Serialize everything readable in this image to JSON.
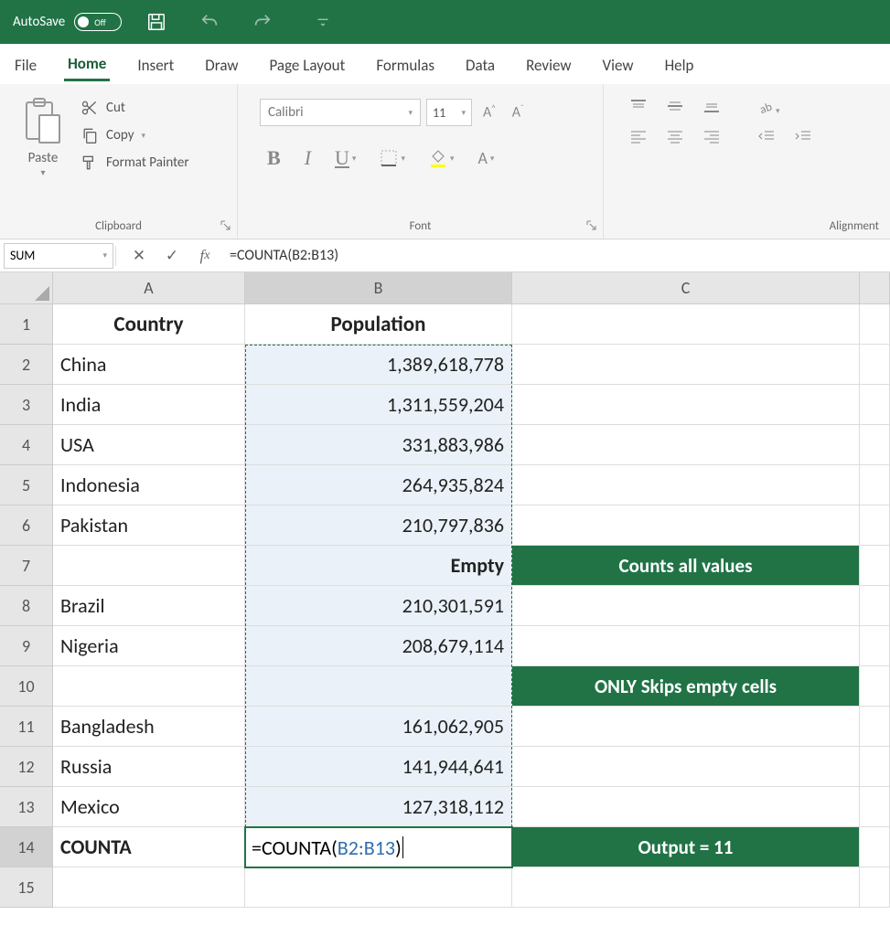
{
  "titlebar": {
    "autosave_label": "AutoSave",
    "autosave_state": "Off"
  },
  "tabs": [
    "File",
    "Home",
    "Insert",
    "Draw",
    "Page Layout",
    "Formulas",
    "Data",
    "Review",
    "View",
    "Help"
  ],
  "active_tab": "Home",
  "ribbon": {
    "clipboard": {
      "paste": "Paste",
      "cut": "Cut",
      "copy": "Copy",
      "format_painter": "Format Painter",
      "group_label": "Clipboard"
    },
    "font": {
      "name": "Calibri",
      "size": "11",
      "group_label": "Font"
    },
    "alignment": {
      "group_label": "Alignment"
    }
  },
  "namebox": "SUM",
  "formula": "=COUNTA(B2:B13)",
  "columns": [
    "A",
    "B",
    "C"
  ],
  "sheet": {
    "headers": {
      "A": "Country",
      "B": "Population"
    },
    "rows": [
      {
        "n": 2,
        "A": "China",
        "B": "1,389,618,778"
      },
      {
        "n": 3,
        "A": "India",
        "B": "1,311,559,204"
      },
      {
        "n": 4,
        "A": "USA",
        "B": "331,883,986"
      },
      {
        "n": 5,
        "A": "Indonesia",
        "B": "264,935,824"
      },
      {
        "n": 6,
        "A": "Pakistan",
        "B": "210,797,836"
      },
      {
        "n": 7,
        "A": "",
        "B": "Empty",
        "B_bold": true,
        "C": "Counts all values"
      },
      {
        "n": 8,
        "A": "Brazil",
        "B": "210,301,591"
      },
      {
        "n": 9,
        "A": "Nigeria",
        "B": "208,679,114"
      },
      {
        "n": 10,
        "A": "",
        "B": "",
        "C": "ONLY Skips empty cells"
      },
      {
        "n": 11,
        "A": "Bangladesh",
        "B": "161,062,905"
      },
      {
        "n": 12,
        "A": "Russia",
        "B": "141,944,641"
      },
      {
        "n": 13,
        "A": "Mexico",
        "B": "127,318,112"
      },
      {
        "n": 14,
        "A": "COUNTA",
        "A_bold": true,
        "B_edit": "=COUNTA(B2:B13)",
        "C": "Output = 11"
      },
      {
        "n": 15,
        "A": "",
        "B": ""
      }
    ]
  },
  "edit_cell": {
    "prefix": "=COUNTA(",
    "ref": "B2:B13",
    "suffix": ")"
  }
}
